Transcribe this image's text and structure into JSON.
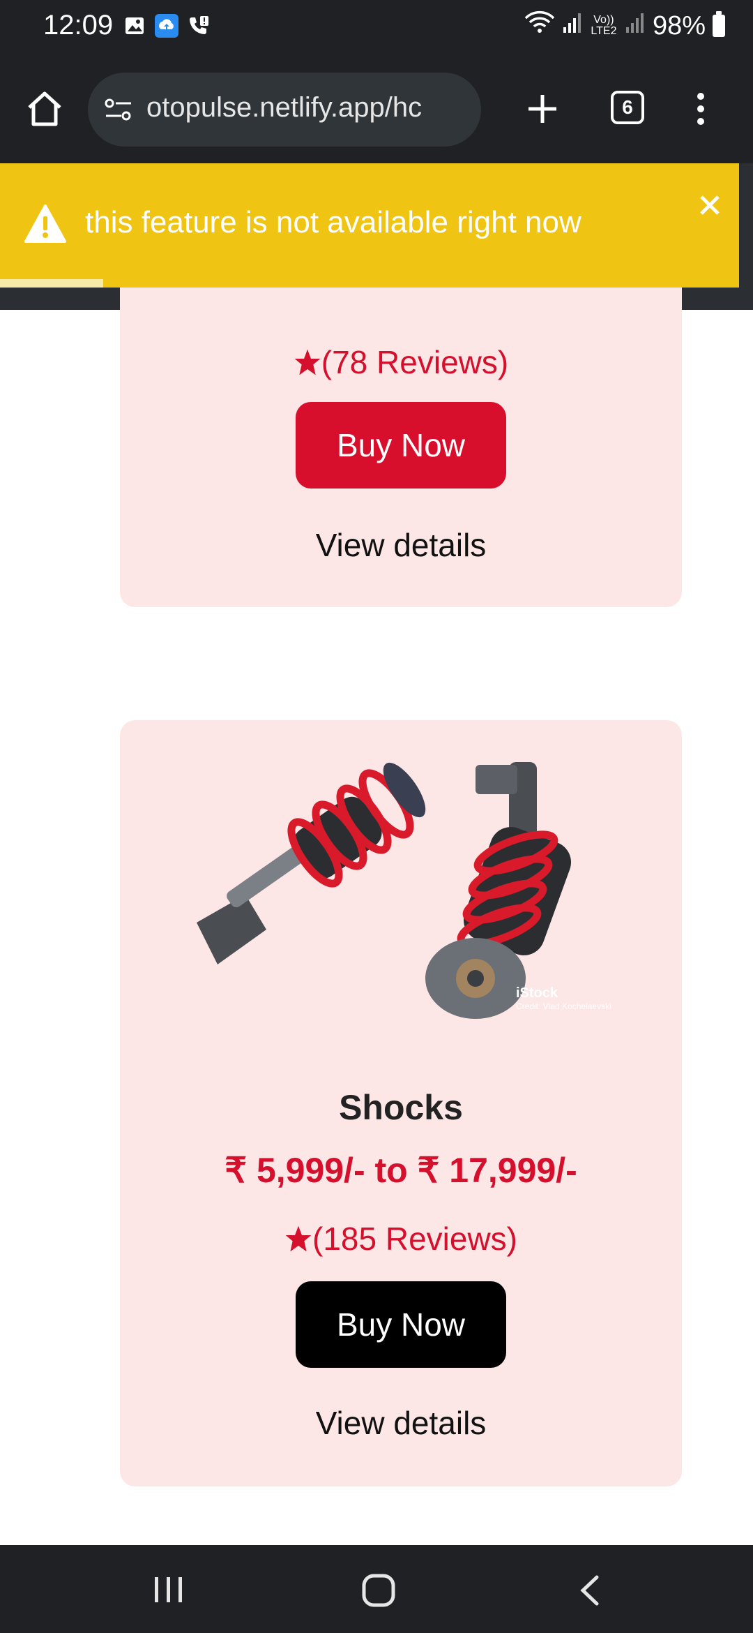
{
  "status_bar": {
    "time": "12:09",
    "network_label": "Vo)) LTE2",
    "battery": "98%",
    "icons": [
      "image-icon",
      "cloud-upload-icon",
      "call-alert-icon",
      "wifi-icon",
      "signal-icon",
      "battery-icon"
    ]
  },
  "browser": {
    "url": "otopulse.netlify.app/hc",
    "tab_count": "6"
  },
  "toast": {
    "message": "this feature is not available right now",
    "background": "#f0c413"
  },
  "products": [
    {
      "rating": "(78  Reviews)",
      "buy_label": "Buy Now",
      "details_label": "View details"
    },
    {
      "name": "Shocks",
      "price": "₹ 5,999/- to ₹ 17,999/-",
      "rating": "(185  Reviews)",
      "buy_label": "Buy Now",
      "details_label": "View details",
      "image_watermark": "iStock",
      "image_credit": "Credit: Vlad Kochelaevski"
    }
  ],
  "colors": {
    "accent_red": "#d80f2c",
    "card_bg": "#fde6e6"
  }
}
